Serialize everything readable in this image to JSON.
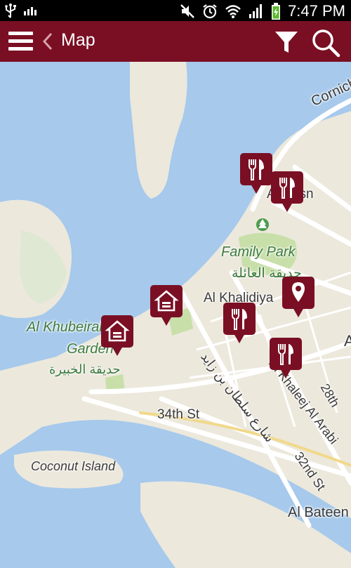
{
  "status_bar": {
    "time": "7:47 PM",
    "icons": [
      "usb-icon",
      "signal-bars-small-icon",
      "mute-icon",
      "alarm-icon",
      "wifi-icon",
      "cell-signal-icon",
      "battery-charging-icon"
    ]
  },
  "app_bar": {
    "title": "Map",
    "icons": [
      "menu-icon",
      "back-chevron-icon",
      "filter-icon",
      "search-icon"
    ]
  },
  "map": {
    "labels": {
      "corniche": "Corniche",
      "al_husn": "Al Husn",
      "family_park_en": "Family Park",
      "family_park_ar": "حديقة العائلة",
      "al_khalidiya": "Al Khalidiya",
      "al_khubeirah": "Al Khubeirah",
      "garden": "Garden",
      "khubeirah_garden_ar": "حديقة الخبيرة",
      "sultan_street_ar": "شارع سلطان بن زايد",
      "34th_st": "34th St",
      "coconut_island": "Coconut Island",
      "al_khaleej_al_arabi": "Al Khaleej Al Arabi",
      "32nd_st": "32nd St",
      "28th": "28th",
      "al_bateen": "Al Bateen",
      "edge_a": "A"
    },
    "colors": {
      "water": "#a6c9ec",
      "land": "#ece8dc",
      "park": "#c8dfa9",
      "marker": "#7a0f24"
    },
    "markers": [
      {
        "type": "restaurant",
        "icon": "fork-knife-icon"
      },
      {
        "type": "restaurant",
        "icon": "fork-knife-icon"
      },
      {
        "type": "hotel",
        "icon": "house-icon"
      },
      {
        "type": "hotel",
        "icon": "house-icon"
      },
      {
        "type": "restaurant",
        "icon": "fork-knife-icon"
      },
      {
        "type": "restaurant",
        "icon": "fork-knife-icon"
      },
      {
        "type": "location",
        "icon": "location-pin-icon"
      }
    ]
  }
}
